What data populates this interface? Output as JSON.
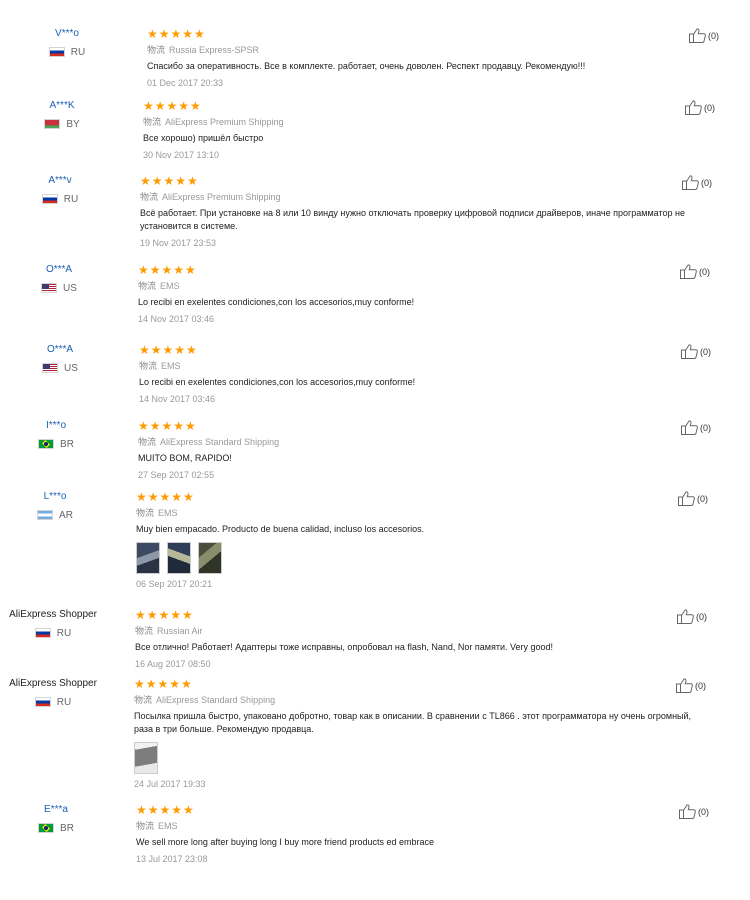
{
  "shipping_label": "物流",
  "star_glyphs": "★★★★★",
  "reviews": [
    {
      "user": "V***o",
      "country": "RU",
      "shipping": "Russia Express-SPSR",
      "text": "Спасибо за оперативность. Все в комплекте. работает, очень доволен. Респект продавцу. Рекомендую!!!",
      "date": "01 Dec 2017 20:33",
      "helpful": "(0)",
      "rating": 5
    },
    {
      "user": "A***K",
      "country": "BY",
      "shipping": "AliExpress Premium Shipping",
      "text": "Все хорошо) пришёл быстро",
      "date": "30 Nov 2017 13:10",
      "helpful": "(0)",
      "rating": 5
    },
    {
      "user": "A***v",
      "country": "RU",
      "shipping": "AliExpress Premium Shipping",
      "text": "Всё работает. При установке на 8 или 10 винду нужно отключать проверку цифровой подписи драйверов, иначе программатор не установится в системе.",
      "date": "19 Nov 2017 23:53",
      "helpful": "(0)",
      "rating": 5
    },
    {
      "user": "O***A",
      "country": "US",
      "shipping": "EMS",
      "text": "Lo recibi en exelentes condiciones,con los accesorios,muy conforme!",
      "date": "14 Nov 2017 03:46",
      "helpful": "(0)",
      "rating": 5
    },
    {
      "user": "O***A",
      "country": "US",
      "shipping": "EMS",
      "text": "Lo recibi en exelentes condiciones,con los accesorios,muy conforme!",
      "date": "14 Nov 2017 03:46",
      "helpful": "(0)",
      "rating": 5
    },
    {
      "user": "I***o",
      "country": "BR",
      "shipping": "AliExpress Standard Shipping",
      "text": "MUITO BOM, RAPIDO!",
      "date": "27 Sep 2017 02:55",
      "helpful": "(0)",
      "rating": 5
    },
    {
      "user": "L***o",
      "country": "AR",
      "shipping": "EMS",
      "text": "Muy bien empacado. Producto de buena calidad, incluso los accesorios.",
      "date": "06 Sep 2017 20:21",
      "helpful": "(0)",
      "rating": 5,
      "photos": 3
    },
    {
      "user": "AliExpress Shopper",
      "country": "RU",
      "shipping": "Russian Air",
      "text": "Все отлично! Работает! Адаптеры тоже исправны, опробовал на flash, Nand, Nor памяти. Very good!",
      "date": "16 Aug 2017 08:50",
      "helpful": "(0)",
      "rating": 5
    },
    {
      "user": "AliExpress Shopper",
      "country": "RU",
      "shipping": "AliExpress Standard Shipping",
      "text": "Посылка пришла быстро, упаковано добротно, товар как в описании. В сравнении с TL866 . этот программатора ну очень огромный, раза в три больше. Рекомендую продавца.",
      "date": "24 Jul 2017 19:33",
      "helpful": "(0)",
      "rating": 5,
      "photos": 1
    },
    {
      "user": "E***a",
      "country": "BR",
      "shipping": "EMS",
      "text": "We sell more long after buying long I buy more friend products ed embrace",
      "date": "13 Jul 2017 23:08",
      "helpful": "(0)",
      "rating": 5
    }
  ]
}
